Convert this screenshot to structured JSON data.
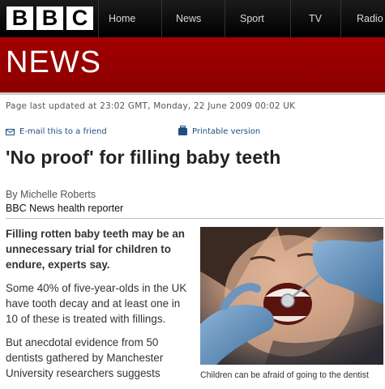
{
  "masthead": {
    "logo_letters": [
      "B",
      "B",
      "C"
    ],
    "nav": [
      "Home",
      "News",
      "Sport",
      "TV",
      "Radio"
    ],
    "section": "NEWS"
  },
  "meta": {
    "updated": "Page last updated at 23:02 GMT, Monday, 22 June 2009 00:02 UK"
  },
  "tools": {
    "email_label": "E-mail this to a friend",
    "email_icon": "email-icon",
    "print_label": "Printable version",
    "print_icon": "printer-icon"
  },
  "article": {
    "headline": "'No proof' for filling baby teeth",
    "author": "By Michelle Roberts",
    "author_role": "BBC News health reporter",
    "intro": "Filling rotten baby teeth may be an unnecessary trial for children to endure, experts say.",
    "para1": "Some 40% of five-year-olds in the UK have tooth decay and at least one in 10 of these is treated with fillings.",
    "para2": "But anecdotal evidence from 50 dentists gathered by Manchester University researchers suggests"
  },
  "image": {
    "caption": "Children can be afraid of going to the dentist"
  },
  "colors": {
    "news_red": "#9b0000",
    "link_blue": "#1f4f82",
    "topbar_black": "#000000"
  }
}
